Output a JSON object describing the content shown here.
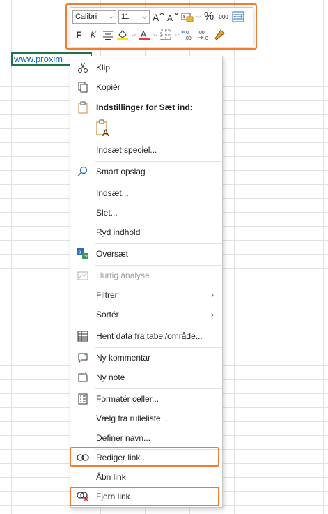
{
  "cell": {
    "text": "www.proxim"
  },
  "toolbar": {
    "font_name": "Calibri",
    "font_size": "11",
    "bold": "F",
    "italic": "K",
    "percent": "%",
    "thousands": "000",
    "font_color": "#e03a3a",
    "fill_color": "#ffe600"
  },
  "menu": {
    "paste_header": "Indstillinger for Sæt ind:",
    "items": {
      "cut": "Klip",
      "copy": "Kopiér",
      "paste_special": "Indsæt speciel...",
      "smart_lookup": "Smart opslag",
      "insert": "Indsæt...",
      "delete": "Slet...",
      "clear": "Ryd indhold",
      "translate": "Oversæt",
      "quick_analysis": "Hurtig analyse",
      "filter": "Filtrer",
      "sort": "Sortér",
      "get_data": "Hent data fra tabel/område...",
      "new_comment": "Ny kommentar",
      "new_note": "Ny note",
      "format_cells": "Formatér celler...",
      "pick_list": "Vælg fra rulleliste...",
      "define_name": "Definer navn...",
      "edit_link": "Rediger link...",
      "open_link": "Åbn link",
      "remove_link": "Fjern link"
    }
  },
  "colors": {
    "highlight": "#ed7d31",
    "accent_green": "#217346",
    "link_blue": "#0563c1"
  }
}
